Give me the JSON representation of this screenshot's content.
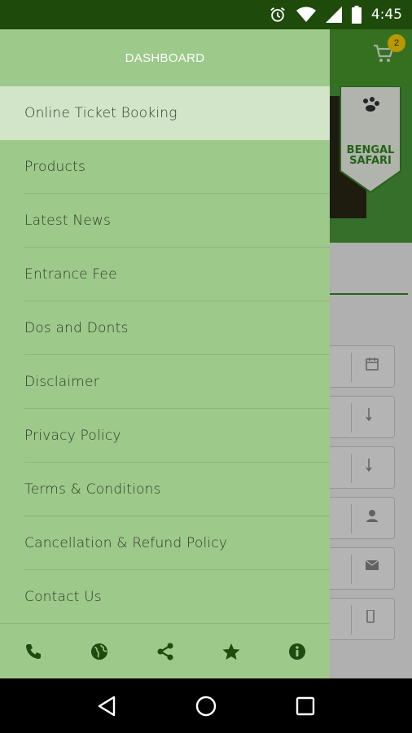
{
  "status_bar": {
    "time": "4:45"
  },
  "app": {
    "cart_count": "2",
    "badge_text": "BENGAL SAFARI"
  },
  "drawer": {
    "header_title": "DASHBOARD",
    "items": [
      {
        "label": "Online Ticket Booking"
      },
      {
        "label": "Products"
      },
      {
        "label": "Latest News"
      },
      {
        "label": "Entrance Fee"
      },
      {
        "label": "Dos and Donts"
      },
      {
        "label": "Disclaimer"
      },
      {
        "label": "Privacy Policy"
      },
      {
        "label": "Terms & Conditions"
      },
      {
        "label": "Cancellation & Refund Policy"
      },
      {
        "label": "Contact Us"
      }
    ],
    "footer_icons": [
      "phone-icon",
      "globe-icon",
      "share-icon",
      "star-icon",
      "info-icon"
    ]
  },
  "colors": {
    "status_bar": "#1e4a0b",
    "drawer": "#9dc98a",
    "active_item": "#d2e5c8",
    "icon": "#1f4a10",
    "accent": "#4a9b2e"
  }
}
